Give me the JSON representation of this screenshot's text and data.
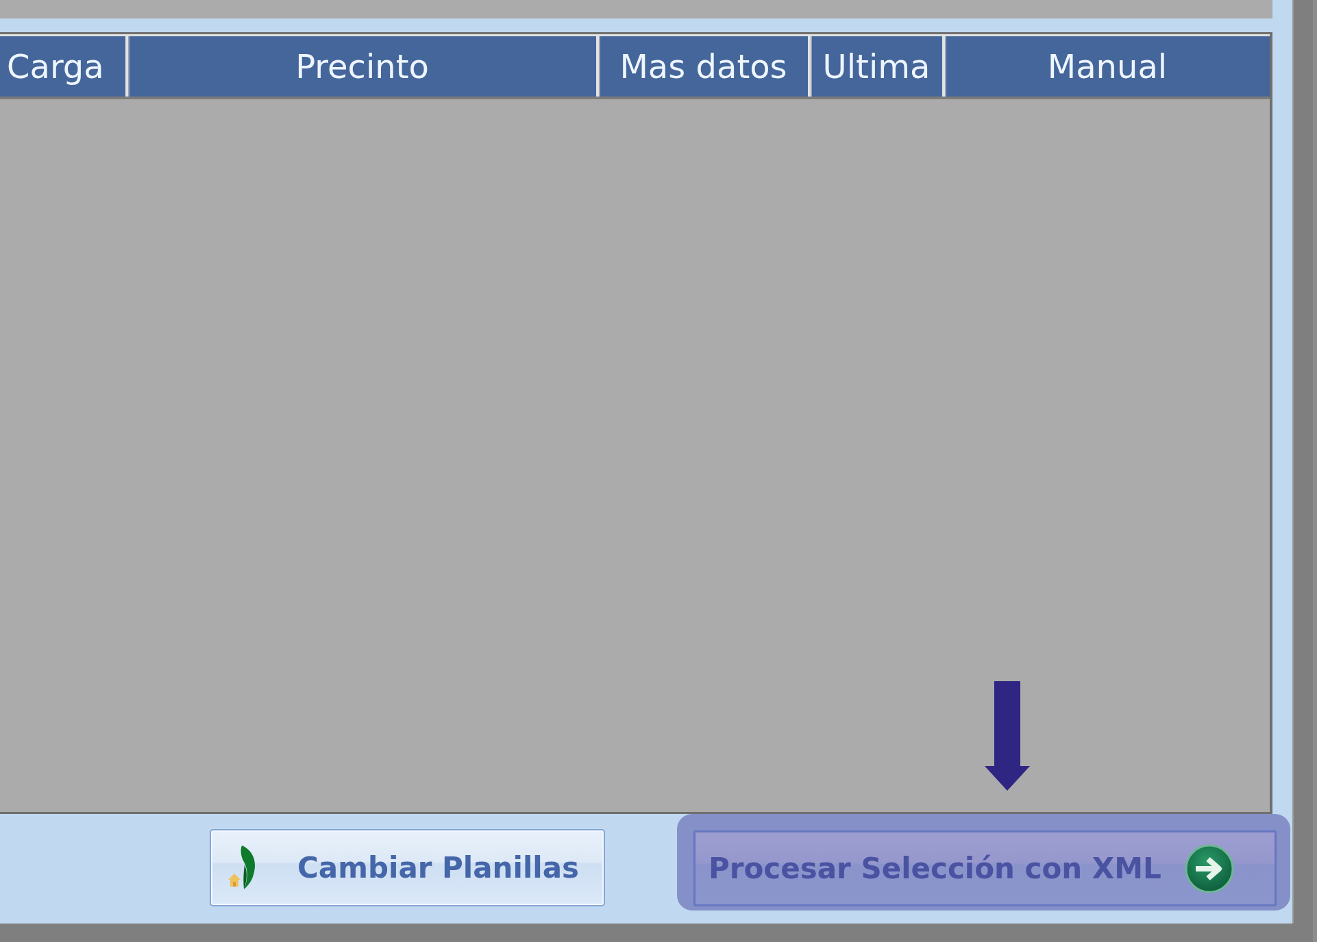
{
  "table": {
    "columns": [
      {
        "label": "Carga"
      },
      {
        "label": "Precinto"
      },
      {
        "label": "Mas datos"
      },
      {
        "label": "Ultima"
      },
      {
        "label": "Manual"
      }
    ]
  },
  "buttons": [
    {
      "label": "Cambiar Planillas",
      "kind": "leaf",
      "highlighted": false
    },
    {
      "label": "Procesar Selección con XML",
      "kind": "next",
      "highlighted": true
    }
  ],
  "annotation": {
    "arrow": true
  }
}
